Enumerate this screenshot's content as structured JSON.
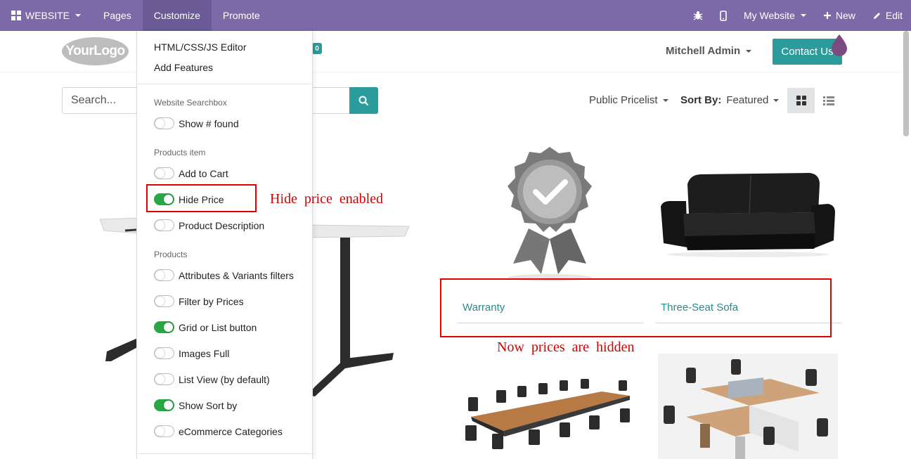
{
  "topbar": {
    "website_label": "WEBSITE",
    "pages_label": "Pages",
    "customize_label": "Customize",
    "promote_label": "Promote",
    "my_website_label": "My Website",
    "new_label": "New",
    "edit_label": "Edit",
    "color": "#7c6aa8"
  },
  "header": {
    "logo_text": "YourLogo",
    "cart_count": "0",
    "user_name": "Mitchell Admin",
    "contact_label": "Contact Us"
  },
  "toolbar": {
    "search_placeholder": "Search...",
    "pricelist_label": "Public Pricelist",
    "sort_prefix": "Sort By:",
    "sort_value": "Featured"
  },
  "customize_menu": {
    "links": [
      "HTML/CSS/JS Editor",
      "Add Features"
    ],
    "sections": [
      {
        "title": "Website Searchbox",
        "options": [
          {
            "label": "Show # found",
            "on": false
          }
        ]
      },
      {
        "title": "Products item",
        "options": [
          {
            "label": "Add to Cart",
            "on": false
          },
          {
            "label": "Hide Price",
            "on": true
          },
          {
            "label": "Product Description",
            "on": false
          }
        ]
      },
      {
        "title": "Products",
        "options": [
          {
            "label": "Attributes & Variants filters",
            "on": false
          },
          {
            "label": "Filter by Prices",
            "on": false
          },
          {
            "label": "Grid or List button",
            "on": true
          },
          {
            "label": "Images Full",
            "on": false
          },
          {
            "label": "List View (by default)",
            "on": false
          },
          {
            "label": "Show Sort by",
            "on": true
          },
          {
            "label": "eCommerce Categories",
            "on": false
          }
        ]
      }
    ]
  },
  "products": [
    {
      "name": "Warranty"
    },
    {
      "name": "Three-Seat Sofa"
    }
  ],
  "annotations": {
    "hide_price_note": "Hide price enabled",
    "prices_hidden_note": "Now prices are hidden",
    "color": "#e20000"
  }
}
